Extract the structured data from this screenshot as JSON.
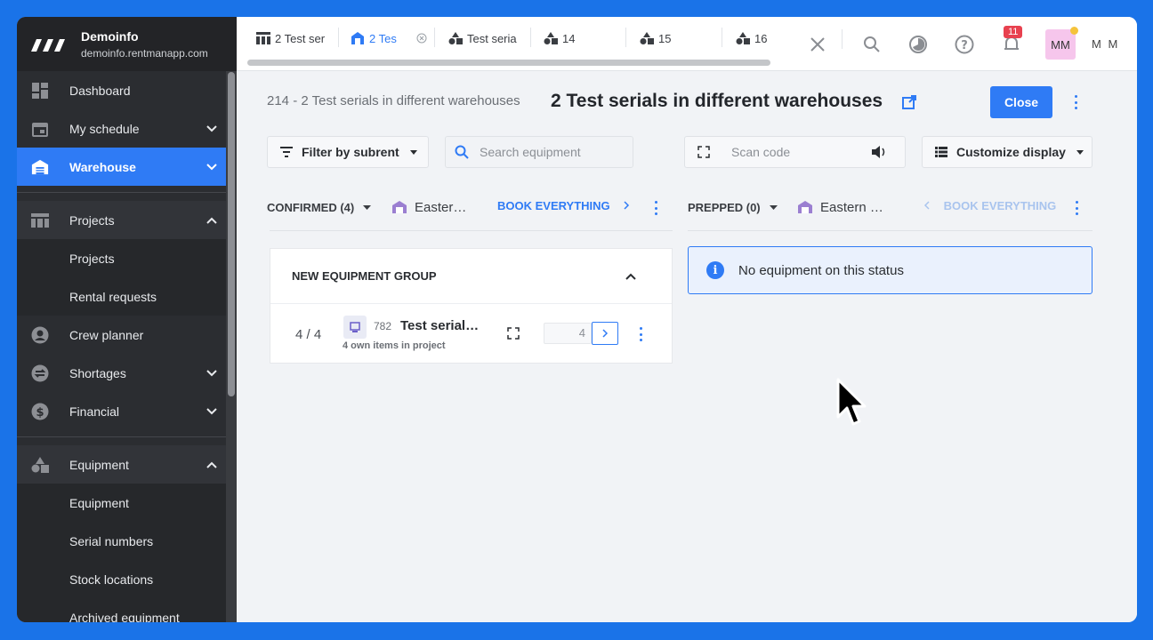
{
  "brand": {
    "name": "Demoinfo",
    "domain": "demoinfo.rentmanapp.com"
  },
  "sidebar": {
    "items": [
      {
        "label": "Dashboard",
        "icon": "dashboard-icon"
      },
      {
        "label": "My schedule",
        "icon": "calendar-icon"
      },
      {
        "label": "Warehouse",
        "icon": "warehouse-icon"
      },
      {
        "label": "Projects",
        "icon": "projects-icon"
      },
      {
        "label": "Crew planner",
        "icon": "person-icon"
      },
      {
        "label": "Shortages",
        "icon": "shortages-icon"
      },
      {
        "label": "Financial",
        "icon": "dollar-icon"
      },
      {
        "label": "Equipment",
        "icon": "equipment-icon"
      }
    ],
    "projects_sub": [
      "Projects",
      "Rental requests"
    ],
    "equipment_sub": [
      "Equipment",
      "Serial numbers",
      "Stock locations",
      "Archived equipment"
    ]
  },
  "tabs": [
    {
      "label": "2 Test ser"
    },
    {
      "label": "2 Tes"
    },
    {
      "label": "Test seria"
    },
    {
      "label": "14"
    },
    {
      "label": "15"
    },
    {
      "label": "16"
    }
  ],
  "topbar": {
    "notifications": "11",
    "avatar": "MM",
    "user": "M M"
  },
  "page": {
    "breadcrumb": "214 - 2 Test serials in different warehouses",
    "title": "2 Test serials in different warehouses",
    "close_label": "Close"
  },
  "toolbar": {
    "filter_label": "Filter by subrent",
    "search_placeholder": "Search equipment",
    "scan_placeholder": "Scan code",
    "customize_label": "Customize display"
  },
  "columns": {
    "left": {
      "status": "CONFIRMED (4)",
      "warehouse": "Easter…",
      "book": "BOOK EVERYTHING"
    },
    "right": {
      "status": "PREPPED (0)",
      "warehouse": "Eastern …",
      "book": "BOOK EVERYTHING"
    }
  },
  "group": {
    "title": "NEW EQUIPMENT GROUP",
    "item": {
      "qty": "4 / 4",
      "number": "782",
      "name": "Test serial…",
      "sub": "4 own items in project",
      "input_value": "4"
    }
  },
  "empty_status": "No equipment on this status",
  "colors": {
    "accent": "#2f7bf5",
    "sidebar": "#2b2d31",
    "badge": "#e8414f",
    "avatar": "#f6c6ec"
  }
}
